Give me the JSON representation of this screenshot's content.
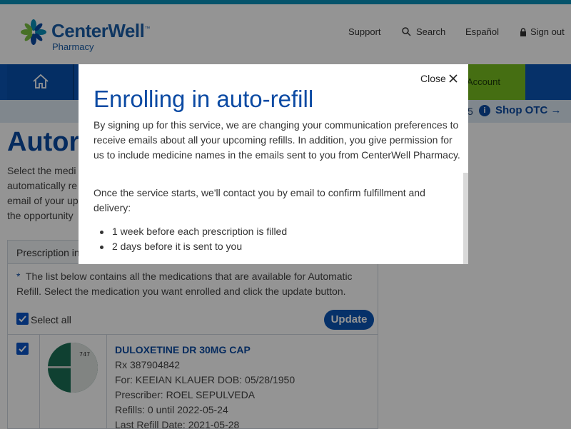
{
  "header": {
    "logo_name": "CenterWell",
    "logo_tm": "™",
    "logo_sub": "Pharmacy",
    "links": {
      "support": "Support",
      "search": "Search",
      "espanol": "Español",
      "signout": "Sign out"
    }
  },
  "nav": {
    "account_label": "Account"
  },
  "subbar": {
    "count": "5",
    "info_glyph": "i",
    "shop_otc": "Shop OTC →"
  },
  "page": {
    "title": "Autor",
    "intro_lines": [
      "Select the medi",
      "automatically re",
      "email of your up",
      "the opportunity"
    ]
  },
  "panel": {
    "header": "Prescription in",
    "note": "The list below contains all the medications that are available for Automatic Refill. Select the medication you want enrolled and click the update button.",
    "note_star": "*",
    "select_all": "Select all",
    "update": "Update"
  },
  "medication": {
    "pill_imprint": "747",
    "name": "DULOXETINE DR 30MG CAP",
    "rx": "Rx  387904842",
    "for": "For:  KEEIAN KLAUER  DOB: 05/28/1950",
    "prescriber": "Prescriber:  ROEL SEPULVEDA",
    "refills": "Refills: 0  until  2022-05-24",
    "last_refill": "Last Refill Date: 2021-05-28"
  },
  "modal": {
    "close": "Close",
    "title": "Enrolling in auto-refill",
    "p1": "By signing up for this service, we are changing your communication preferences to receive emails about all your upcoming refills. In addition, you give permission for us to include medicine names in the emails sent to you from CenterWell Pharmacy.",
    "p2": "Once the service starts, we'll contact you by email to confirm fulfillment and delivery:",
    "bullets": [
      "1 week before each prescription is filled",
      "2 days before it is sent to you"
    ]
  },
  "colors": {
    "brand_blue": "#0b4aa3",
    "nav_blue": "#0b55b5",
    "account_green": "#78be20",
    "pill_green": "#1a6e55"
  },
  "icons": [
    "home-icon",
    "search-icon",
    "lock-icon",
    "info-icon",
    "close-icon",
    "checkbox-checked-icon"
  ]
}
